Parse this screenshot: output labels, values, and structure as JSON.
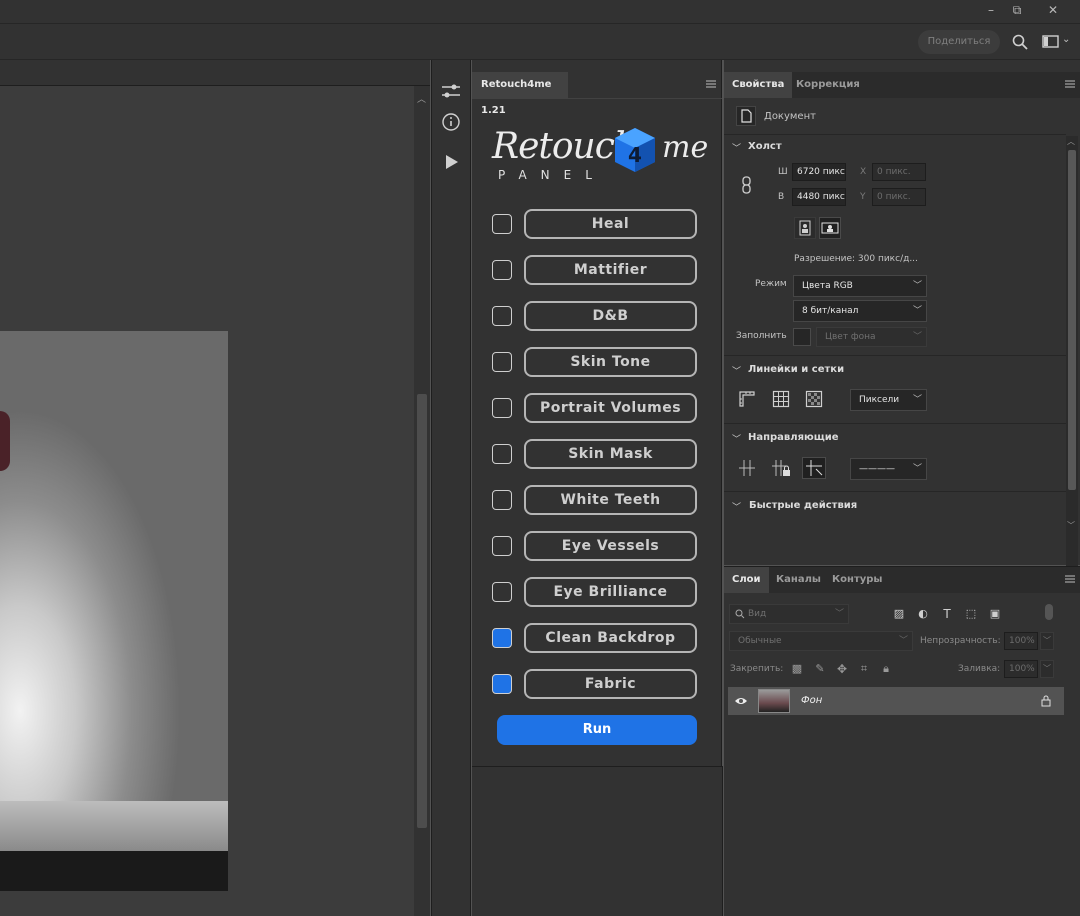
{
  "window": {
    "minimize_glyph": "–",
    "restore_glyph": "⧉",
    "close_glyph": "✕"
  },
  "optionsbar": {
    "share_label": "Поделиться"
  },
  "retouch_panel": {
    "tab_title": "Retouch4me 1.21",
    "logo_word": "Retouch",
    "logo_suffix": "me",
    "logo_sub": "PANEL",
    "items": [
      {
        "label": "Heal",
        "checked": false
      },
      {
        "label": "Mattifier",
        "checked": false
      },
      {
        "label": "D&B",
        "checked": false
      },
      {
        "label": "Skin Tone",
        "checked": false
      },
      {
        "label": "Portrait Volumes",
        "checked": false
      },
      {
        "label": "Skin Mask",
        "checked": false
      },
      {
        "label": "White Teeth",
        "checked": false
      },
      {
        "label": "Eye Vessels",
        "checked": false
      },
      {
        "label": "Eye Brilliance",
        "checked": false
      },
      {
        "label": "Clean Backdrop",
        "checked": true
      },
      {
        "label": "Fabric",
        "checked": true
      }
    ],
    "run_label": "Run",
    "accent_color": "#1f73e6"
  },
  "properties": {
    "tabs": [
      "Свойства",
      "Коррекция"
    ],
    "doc_label": "Документ",
    "canvas": {
      "header": "Холст",
      "w_label": "Ш",
      "w_value": "6720 пикс",
      "h_label": "В",
      "h_value": "4480 пикс",
      "x_label": "X",
      "x_placeholder": "0 пикс.",
      "y_label": "Y",
      "y_placeholder": "0 пикс.",
      "resolution": "Разрешение: 300 пикс/д...",
      "mode_label": "Режим",
      "mode_value": "Цвета RGB",
      "depth_value": "8 бит/канал",
      "fill_label": "Заполнить",
      "fill_value": "Цвет фона"
    },
    "rulers": {
      "header": "Линейки и сетки",
      "units_value": "Пиксели"
    },
    "guides": {
      "header": "Направляющие",
      "style_value": "————"
    },
    "quick_actions": {
      "header": "Быстрые действия"
    }
  },
  "layers": {
    "tabs": [
      "Слои",
      "Каналы",
      "Контуры"
    ],
    "search_placeholder": "Вид",
    "blend_mode": "Обычные",
    "opacity_label": "Непрозрачность:",
    "opacity_value": "100%",
    "lock_label": "Закрепить:",
    "fill_label": "Заливка:",
    "fill_value": "100%",
    "layer_name": "Фон"
  }
}
